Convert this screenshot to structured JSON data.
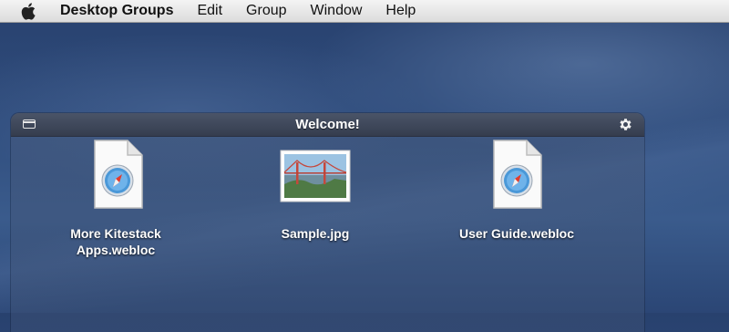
{
  "menubar": {
    "apple_icon": "apple-logo-icon",
    "app_name": "Desktop Groups",
    "items": [
      "Edit",
      "Group",
      "Window",
      "Help"
    ]
  },
  "panel": {
    "title": "Welcome!",
    "collapse_icon": "window-collapse-icon",
    "settings_icon": "gear-icon",
    "items": [
      {
        "label_line1": "More Kitestack",
        "label_line2": "Apps.webloc",
        "icon": "safari-webloc-file-icon"
      },
      {
        "label_line1": "Sample.jpg",
        "label_line2": "",
        "icon": "image-thumbnail-icon"
      },
      {
        "label_line1": "User Guide.webloc",
        "label_line2": "",
        "icon": "safari-webloc-file-icon"
      }
    ]
  },
  "colors": {
    "desktop": "#2f4c7c",
    "titlebar": "#3f4859",
    "menubar": "#e8e8e8"
  }
}
